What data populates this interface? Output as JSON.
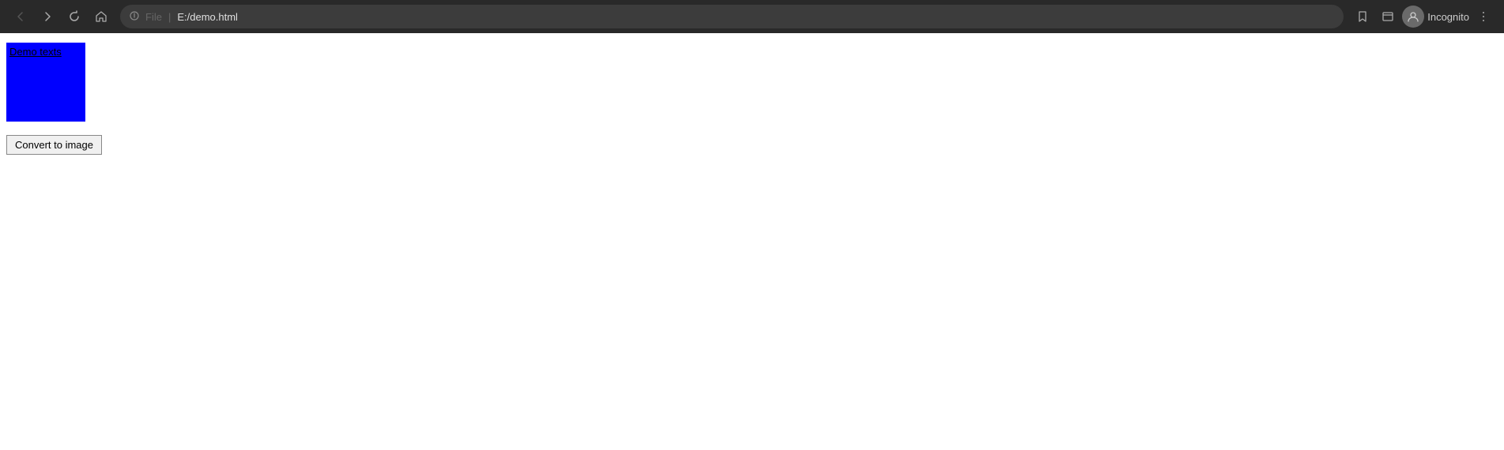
{
  "browser": {
    "back_title": "Back",
    "forward_title": "Forward",
    "refresh_title": "Refresh",
    "home_title": "Home",
    "address": {
      "file_label": "File",
      "separator": "|",
      "url": "E:/demo.html"
    },
    "bookmark_title": "Bookmark",
    "tab_title": "Tab strip",
    "profile_label": "Incognito",
    "menu_title": "Menu"
  },
  "page": {
    "demo_box_text": "Demo texts",
    "convert_button_label": "Convert to image"
  }
}
